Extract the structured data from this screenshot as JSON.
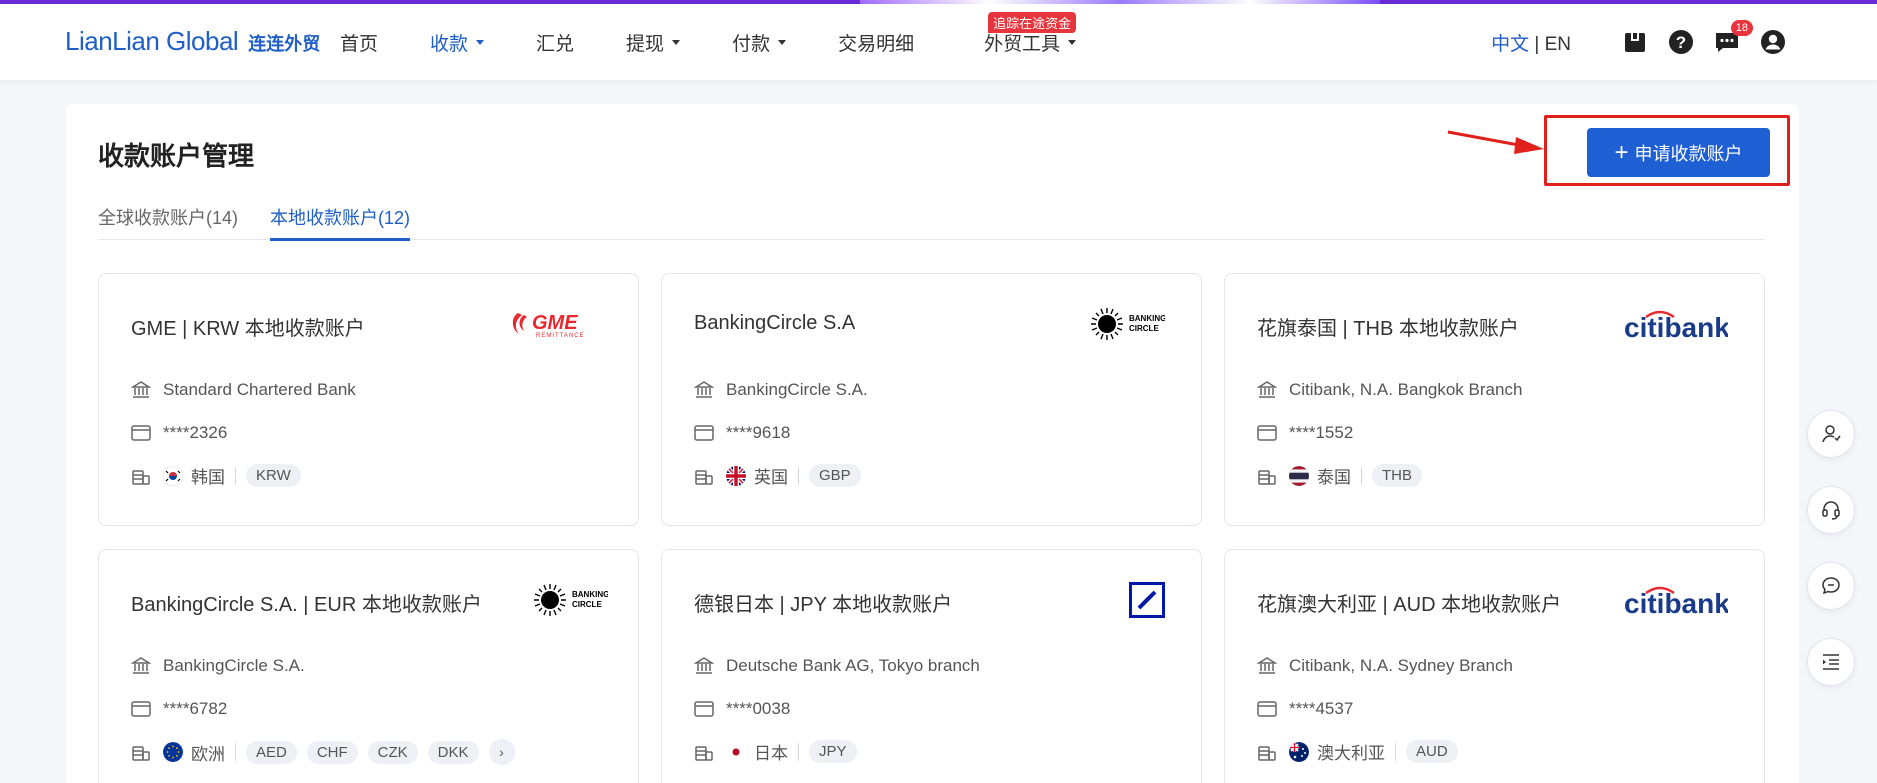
{
  "brand": {
    "name_en": "LianLian Global",
    "name_cn": "连连外贸",
    "color": "#1f5fc7"
  },
  "nav": [
    {
      "label": "首页",
      "active": false,
      "dropdown": false
    },
    {
      "label": "收款",
      "active": true,
      "dropdown": true
    },
    {
      "label": "汇兑",
      "active": false,
      "dropdown": false
    },
    {
      "label": "提现",
      "active": false,
      "dropdown": true
    },
    {
      "label": "付款",
      "active": false,
      "dropdown": true
    },
    {
      "label": "交易明细",
      "active": false,
      "dropdown": false
    },
    {
      "label": "外贸工具",
      "active": false,
      "dropdown": true,
      "badge": "追踪在途资金"
    }
  ],
  "header_right": {
    "lang_zh": "中文",
    "lang_sep": " | ",
    "lang_en": "EN",
    "message_count": "18"
  },
  "page": {
    "title": "收款账户管理",
    "apply_button": "申请收款账户",
    "tabs": [
      {
        "label": "全球收款账户(14)",
        "active": false
      },
      {
        "label": "本地收款账户(12)",
        "active": true
      }
    ]
  },
  "cards": [
    {
      "title": "GME | KRW 本地收款账户",
      "logo": "GME",
      "bank": "Standard Chartered Bank",
      "account": "****2326",
      "region": "韩国",
      "flag": "kr",
      "currencies": [
        "KRW"
      ]
    },
    {
      "title": "BankingCircle S.A",
      "logo": "BANKING CIRCLE",
      "bank": "BankingCircle S.A.",
      "account": "****9618",
      "region": "英国",
      "flag": "gb",
      "currencies": [
        "GBP"
      ]
    },
    {
      "title": "花旗泰国 | THB 本地收款账户",
      "logo": "citibank",
      "bank": "Citibank, N.A. Bangkok Branch",
      "account": "****1552",
      "region": "泰国",
      "flag": "th",
      "currencies": [
        "THB"
      ]
    },
    {
      "title": "BankingCircle S.A. | EUR 本地收款账户",
      "logo": "BANKING CIRCLE",
      "bank": "BankingCircle S.A.",
      "account": "****6782",
      "region": "欧洲",
      "flag": "eu",
      "currencies": [
        "AED",
        "CHF",
        "CZK",
        "DKK"
      ],
      "more": true
    },
    {
      "title": "德银日本 | JPY 本地收款账户",
      "logo": "deutsche",
      "bank": "Deutsche Bank AG, Tokyo branch",
      "account": "****0038",
      "region": "日本",
      "flag": "jp",
      "currencies": [
        "JPY"
      ]
    },
    {
      "title": "花旗澳大利亚 | AUD 本地收款账户",
      "logo": "citibank",
      "bank": "Citibank, N.A. Sydney Branch",
      "account": "****4537",
      "region": "澳大利亚",
      "flag": "au",
      "currencies": [
        "AUD"
      ]
    }
  ],
  "float_tools": [
    "account-manager-icon",
    "headset-icon",
    "chat-icon",
    "list-indent-icon"
  ]
}
